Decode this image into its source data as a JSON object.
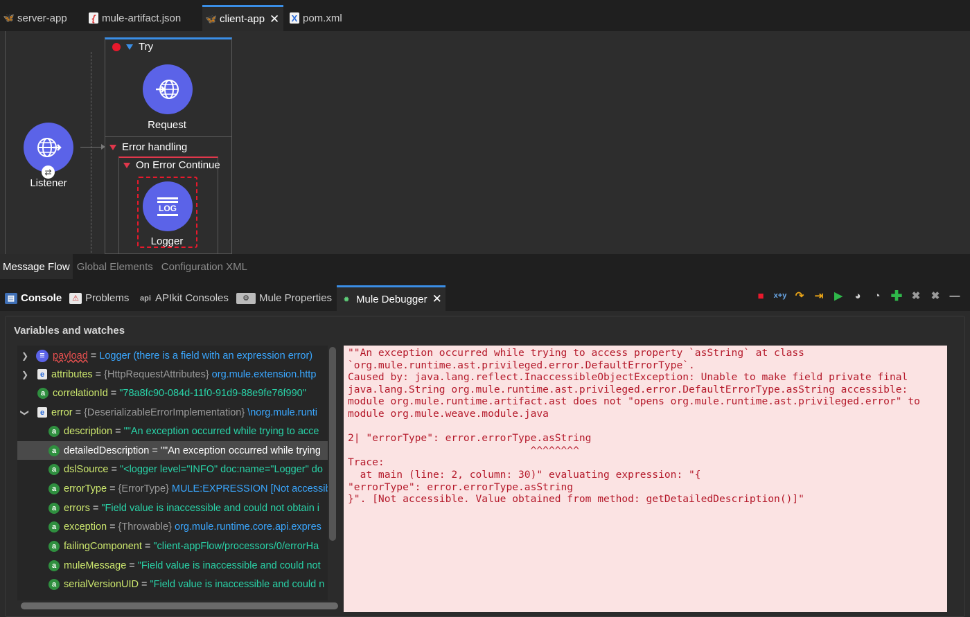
{
  "editor_tabs": [
    {
      "label": "server-app",
      "icon": "mule-icon"
    },
    {
      "label": "mule-artifact.json",
      "icon": "json-file-icon"
    },
    {
      "label": "client-app",
      "icon": "mule-icon",
      "active": true
    },
    {
      "label": "pom.xml",
      "icon": "xml-file-icon"
    }
  ],
  "canvas": {
    "try_label": "Try",
    "request_label": "Request",
    "listener_label": "Listener",
    "error_handling_label": "Error handling",
    "on_error_continue_label": "On Error Continue",
    "logger_label": "Logger",
    "logger_icon_text": "LOG"
  },
  "editor_bottom_tabs": [
    "Message Flow",
    "Global Elements",
    "Configuration XML"
  ],
  "view_tabs": [
    {
      "label": "Console",
      "icon": "console-icon"
    },
    {
      "label": "Problems",
      "icon": "problems-icon"
    },
    {
      "label": "APIkit Consoles",
      "icon": "api-icon",
      "icon_text": "api"
    },
    {
      "label": "Mule Properties",
      "icon": "mule-properties-icon"
    },
    {
      "label": "Mule Debugger",
      "icon": "bug-icon",
      "active": true
    }
  ],
  "toolbar_icons": [
    "stop-icon",
    "evaluate-icon",
    "step-over-icon",
    "step-into-icon",
    "resume-icon",
    "breakpoint-icon",
    "breakpoint-remove-icon",
    "add-watch-icon",
    "remove-watch-icon",
    "remove-all-icon",
    "minimize-icon"
  ],
  "colors": {
    "accent": "#3a8ee6",
    "node": "#5b63e8",
    "error": "#e8192c",
    "detail_bg": "#fbe3e3"
  },
  "debugger": {
    "section_title": "Variables and watches",
    "variables": [
      {
        "name": "payload",
        "value": "Logger (there is a field with an expression error)"
      },
      {
        "name": "attributes",
        "type": "{HttpRequestAttributes}",
        "value": "org.mule.extension.http"
      },
      {
        "name": "correlationId",
        "value": "\"78a8fc90-084d-11f0-91d9-88e9fe76f990\""
      },
      {
        "name": "error",
        "type": "{DeserializableErrorImplementation}",
        "value": "\\norg.mule.runti"
      },
      {
        "name": "description",
        "value": "\"\"An exception occurred while trying to acce"
      },
      {
        "name": "detailedDescription",
        "value": "\"\"An exception occurred while trying"
      },
      {
        "name": "dslSource",
        "value": "\"<logger level=\"INFO\" doc:name=\"Logger\" do"
      },
      {
        "name": "errorType",
        "type": "{ErrorType}",
        "value": "MULE:EXPRESSION [Not accessib"
      },
      {
        "name": "errors",
        "value": "\"Field value is inaccessible and could not obtain i"
      },
      {
        "name": "exception",
        "type": "{Throwable}",
        "value": "org.mule.runtime.core.api.expres"
      },
      {
        "name": "failingComponent",
        "value": "\"client-appFlow/processors/0/errorHa"
      },
      {
        "name": "muleMessage",
        "value": "\"Field value is inaccessible and could not"
      },
      {
        "name": "serialVersionUID",
        "value": "\"Field value is inaccessible and could n"
      }
    ],
    "detail_lines": [
      "\"\"An exception occurred while trying to access property `asString` at class",
      "`org.mule.runtime.ast.privileged.error.DefaultErrorType`.",
      "Caused by: java.lang.reflect.InaccessibleObjectException: Unable to make field private final",
      "java.lang.String org.mule.runtime.ast.privileged.error.DefaultErrorType.asString accessible:",
      "module org.mule.runtime.artifact.ast does not \"opens org.mule.runtime.ast.privileged.error\" to",
      "module org.mule.weave.module.java",
      "",
      "2| \"errorType\": error.errorType.asString",
      "                              ^^^^^^^^",
      "Trace:",
      "  at main (line: 2, column: 30)\" evaluating expression: \"{",
      "\"errorType\": error.errorType.asString",
      "}\". [Not accessible. Value obtained from method: getDetailedDescription()]\""
    ]
  }
}
